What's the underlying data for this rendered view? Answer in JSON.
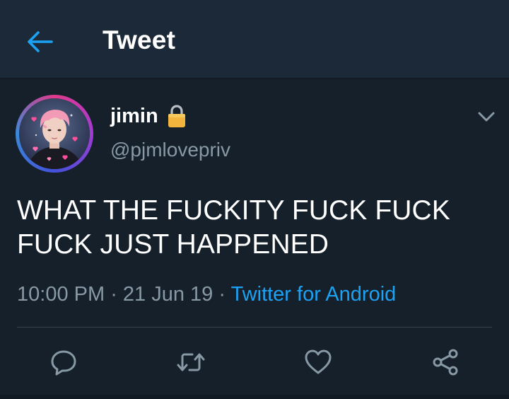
{
  "header": {
    "title": "Tweet",
    "back_icon": "arrow-left-icon"
  },
  "tweet": {
    "author": {
      "display_name": "jimin",
      "handle": "@pjmlovepriv",
      "protected_icon": "lock-icon"
    },
    "text_line1": "WHAT THE FUCKITY FUCK FUCK",
    "text_line2": "FUCK JUST HAPPENED",
    "time": "10:00 PM",
    "separator": " · ",
    "date": "21 Jun 19",
    "source": "Twitter for Android",
    "actions": [
      "reply-icon",
      "retweet-icon",
      "like-icon",
      "share-icon"
    ]
  },
  "colors": {
    "background": "#15202b",
    "header": "#1c2938",
    "accent": "#1da1f2",
    "secondary_text": "#8899a6"
  }
}
